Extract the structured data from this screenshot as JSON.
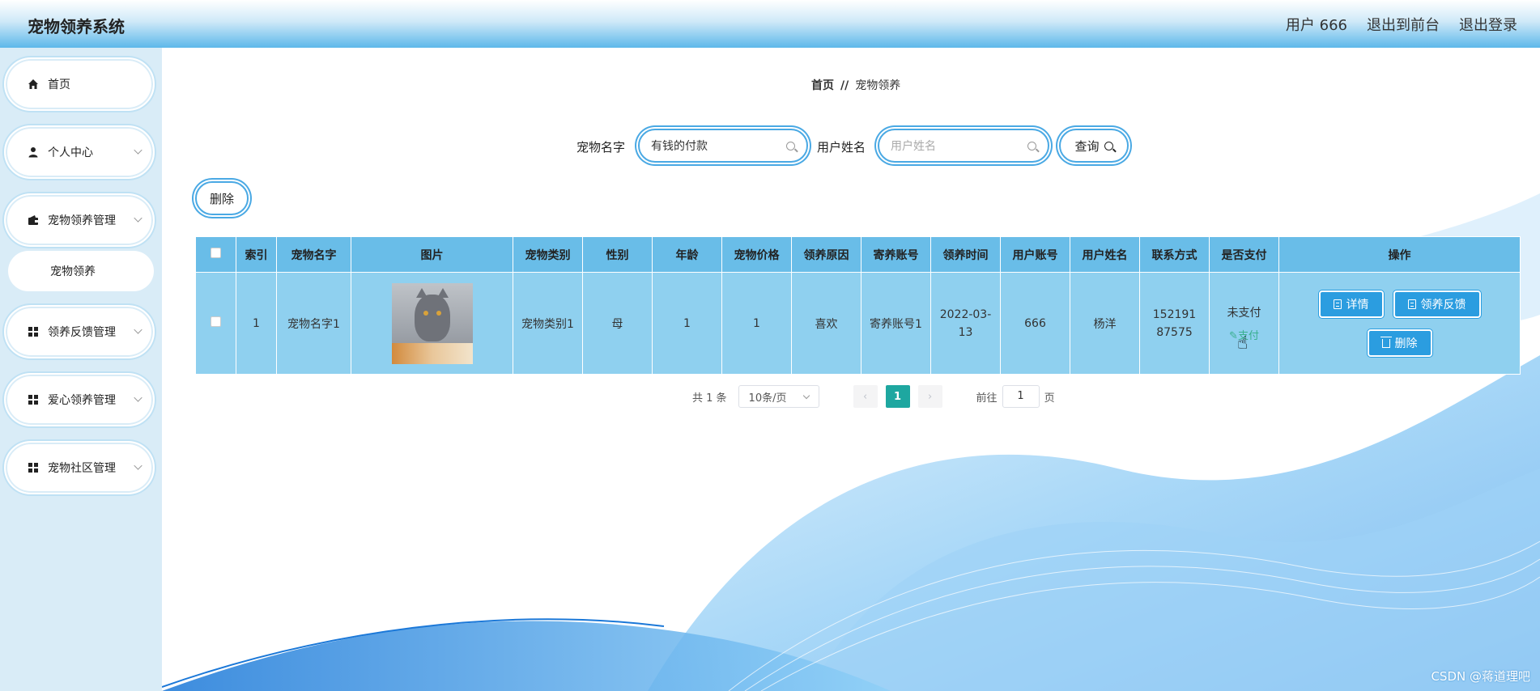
{
  "header": {
    "title": "宠物领养系统",
    "user": "用户 666",
    "exit_front": "退出到前台",
    "logout": "退出登录"
  },
  "sidebar": {
    "items": [
      {
        "label": "首页",
        "icon": "home-icon"
      },
      {
        "label": "个人中心",
        "icon": "user-icon"
      },
      {
        "label": "宠物领养管理",
        "icon": "wallet-icon"
      },
      {
        "label": "宠物领养",
        "icon": ""
      },
      {
        "label": "领养反馈管理",
        "icon": "grid-icon"
      },
      {
        "label": "爱心领养管理",
        "icon": "grid-icon"
      },
      {
        "label": "宠物社区管理",
        "icon": "grid-icon"
      }
    ]
  },
  "breadcrumb": {
    "home": "首页",
    "sep": "//",
    "current": "宠物领养"
  },
  "search": {
    "pet_name_label": "宠物名字",
    "pet_name_value": "有钱的付款",
    "user_name_label": "用户姓名",
    "user_name_placeholder": "用户姓名",
    "query_button": "查询"
  },
  "toolbar": {
    "delete_button": "删除"
  },
  "table": {
    "headers": [
      "索引",
      "宠物名字",
      "图片",
      "宠物类别",
      "性别",
      "年龄",
      "宠物价格",
      "领养原因",
      "寄养账号",
      "领养时间",
      "用户账号",
      "用户姓名",
      "联系方式",
      "是否支付",
      "操作"
    ],
    "rows": [
      {
        "index": "1",
        "pet_name": "宠物名字1",
        "category": "宠物类别1",
        "gender": "母",
        "age": "1",
        "price": "1",
        "reason": "喜欢",
        "foster_account": "寄养账号1",
        "adopt_time": "2022-03-13",
        "user_account": "666",
        "user_name": "杨洋",
        "contact": "15219187575",
        "paid_status": "未支付",
        "pay_link": "支付",
        "ops": {
          "detail": "详情",
          "feedback": "领养反馈",
          "delete": "删除"
        }
      }
    ]
  },
  "pagination": {
    "total": "共 1 条",
    "page_size": "10条/页",
    "current_page": "1",
    "goto_label": "前往",
    "goto_value": "1",
    "page_suffix": "页"
  },
  "watermark": "CSDN @蒋道理吧",
  "colors": {
    "accent": "#2b9de0",
    "header_th": "#69bde8",
    "row_bg": "#8fd0ef",
    "page_active": "#1ea7a0"
  }
}
